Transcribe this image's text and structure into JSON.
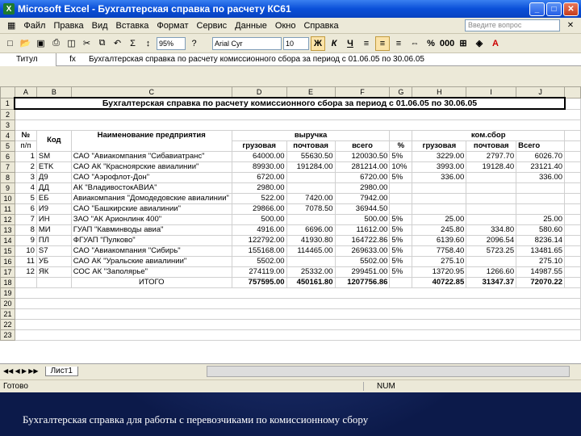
{
  "window": {
    "title": "Microsoft Excel - Бухгалтерская справка по расчету КС61",
    "icon": "excel-icon"
  },
  "menu": [
    "Файл",
    "Правка",
    "Вид",
    "Вставка",
    "Формат",
    "Сервис",
    "Данные",
    "Окно",
    "Справка"
  ],
  "help_placeholder": "Введите вопрос",
  "toolbar": {
    "zoom": "95%",
    "font": "Arial Cyr",
    "size": "10",
    "bold": "Ж",
    "italic": "К",
    "underline": "Ч",
    "percent": "%",
    "sigma": "Σ"
  },
  "formula": {
    "namebox": "Титул",
    "fx": "fx",
    "content": "Бухгалтерская справка по расчету комиссионного сбора за период с 01.06.05 по 30.06.05"
  },
  "columns": [
    "A",
    "B",
    "C",
    "D",
    "E",
    "F",
    "G",
    "H",
    "I",
    "J"
  ],
  "title": "Бухгалтерская справка по расчету комиссионного сбора за период с 01.06.05 по 30.06.05",
  "headers": {
    "num": "№",
    "np": "п/п",
    "code": "Код",
    "name": "Наименование предприятия",
    "rev": "выручка",
    "cargo": "грузовая",
    "post": "почтовая",
    "total": "всего",
    "pct": "%",
    "fee": "ком.сбор",
    "fee_cargo": "грузовая",
    "fee_post": "почтовая",
    "fee_total": "Всего"
  },
  "rows": [
    {
      "n": "1",
      "code": "SM",
      "name": "САО \"Авиакомпания \"Сибавиатранс\"",
      "cargo": "64000.00",
      "post": "55630.50",
      "total": "120030.50",
      "pct": "5%",
      "fc": "3229.00",
      "fp": "2797.70",
      "ft": "6026.70"
    },
    {
      "n": "2",
      "code": "ETK",
      "name": "САО АК \"Красноярские авиалинии\"",
      "cargo": "89930.00",
      "post": "191284.00",
      "total": "281214.00",
      "pct": "10%",
      "fc": "3993.00",
      "fp": "19128.40",
      "ft": "23121.40"
    },
    {
      "n": "3",
      "code": "Д9",
      "name": "САО \"Аэрофлот-Дон\"",
      "cargo": "6720.00",
      "post": "",
      "total": "6720.00",
      "pct": "5%",
      "fc": "336.00",
      "fp": "",
      "ft": "336.00"
    },
    {
      "n": "4",
      "code": "ДД",
      "name": "АК \"ВладивостокАВИА\"",
      "cargo": "2980.00",
      "post": "",
      "total": "2980.00",
      "pct": "",
      "fc": "",
      "fp": "",
      "ft": ""
    },
    {
      "n": "5",
      "code": "ЕБ",
      "name": "Авиакомпания \"Домодедовские авиалинии\"",
      "cargo": "522.00",
      "post": "7420.00",
      "total": "7942.00",
      "pct": "",
      "fc": "",
      "fp": "",
      "ft": ""
    },
    {
      "n": "6",
      "code": "И9",
      "name": "САО \"Башкирские авиалинии\"",
      "cargo": "29866.00",
      "post": "7078.50",
      "total": "36944.50",
      "pct": "",
      "fc": "",
      "fp": "",
      "ft": ""
    },
    {
      "n": "7",
      "code": "ИН",
      "name": "ЗАО \"АК Арионлинк 400\"",
      "cargo": "500.00",
      "post": "",
      "total": "500.00",
      "pct": "5%",
      "fc": "25.00",
      "fp": "",
      "ft": "25.00"
    },
    {
      "n": "8",
      "code": "МИ",
      "name": "ГУАП \"Кавминводы авиа\"",
      "cargo": "4916.00",
      "post": "6696.00",
      "total": "11612.00",
      "pct": "5%",
      "fc": "245.80",
      "fp": "334.80",
      "ft": "580.60"
    },
    {
      "n": "9",
      "code": "ПЛ",
      "name": "ФГУАП \"Пулково\"",
      "cargo": "122792.00",
      "post": "41930.80",
      "total": "164722.86",
      "pct": "5%",
      "fc": "6139.60",
      "fp": "2096.54",
      "ft": "8236.14"
    },
    {
      "n": "10",
      "code": "S7",
      "name": "САО \"Авиакомпания \"Сибирь\"",
      "cargo": "155168.00",
      "post": "114465.00",
      "total": "269633.00",
      "pct": "5%",
      "fc": "7758.40",
      "fp": "5723.25",
      "ft": "13481.65"
    },
    {
      "n": "11",
      "code": "УБ",
      "name": "САО АК \"Уральские авиалинии\"",
      "cargo": "5502.00",
      "post": "",
      "total": "5502.00",
      "pct": "5%",
      "fc": "275.10",
      "fp": "",
      "ft": "275.10"
    },
    {
      "n": "12",
      "code": "ЯК",
      "name": "СОС АК \"Заполярье\"",
      "cargo": "274119.00",
      "post": "25332.00",
      "total": "299451.00",
      "pct": "5%",
      "fc": "13720.95",
      "fp": "1266.60",
      "ft": "14987.55"
    }
  ],
  "total_row": {
    "label": "ИТОГО",
    "cargo": "757595.00",
    "post": "450161.80",
    "total": "1207756.86",
    "fc": "40722.85",
    "fp": "31347.37",
    "ft": "72070.22"
  },
  "sheet_tab": "Лист1",
  "status": {
    "ready": "Готово",
    "num": "NUM"
  },
  "caption": "Бухгалтерская справка для работы с перевозчиками по комиссионному сбору"
}
